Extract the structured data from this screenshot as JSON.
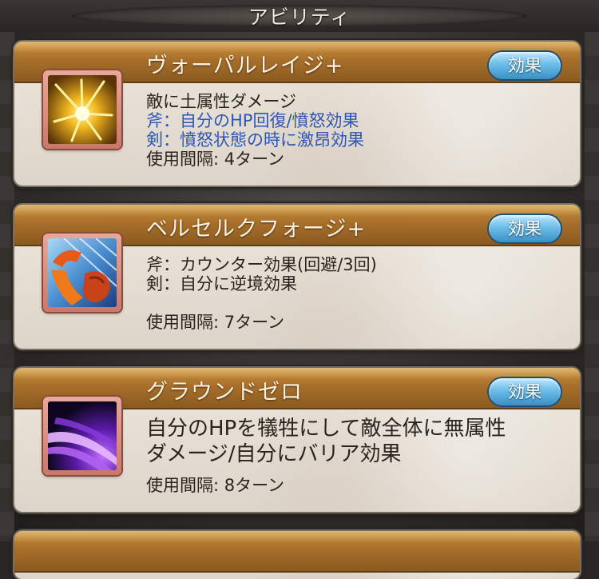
{
  "section_title": "アビリティ",
  "effect_label": "効果",
  "abilities": [
    {
      "name": "ヴォーパルレイジ+",
      "icon": "golden-burst-icon",
      "lines": [
        "敵に土属性ダメージ",
        "斧：自分のHP回復/憤怒効果",
        "剣：憤怒状態の時に激昂効果"
      ],
      "cooldown": "使用間隔: 4ターン"
    },
    {
      "name": "ベルセルクフォージ+",
      "icon": "fist-strike-icon",
      "lines": [
        "斧：カウンター効果(回避/3回)",
        "剣：自分に逆境効果"
      ],
      "cooldown": "使用間隔: 7ターン"
    },
    {
      "name": "グラウンドゼロ",
      "icon": "purple-slash-icon",
      "lines": [
        "自分のHPを犠牲にして敵全体に無属性",
        "ダメージ/自分にバリア効果"
      ],
      "cooldown": "使用間隔: 8ターン"
    }
  ],
  "colors": {
    "title_bar": "#a86f2a",
    "button": "#6cbde8",
    "highlight_text": "#2e56b8"
  }
}
